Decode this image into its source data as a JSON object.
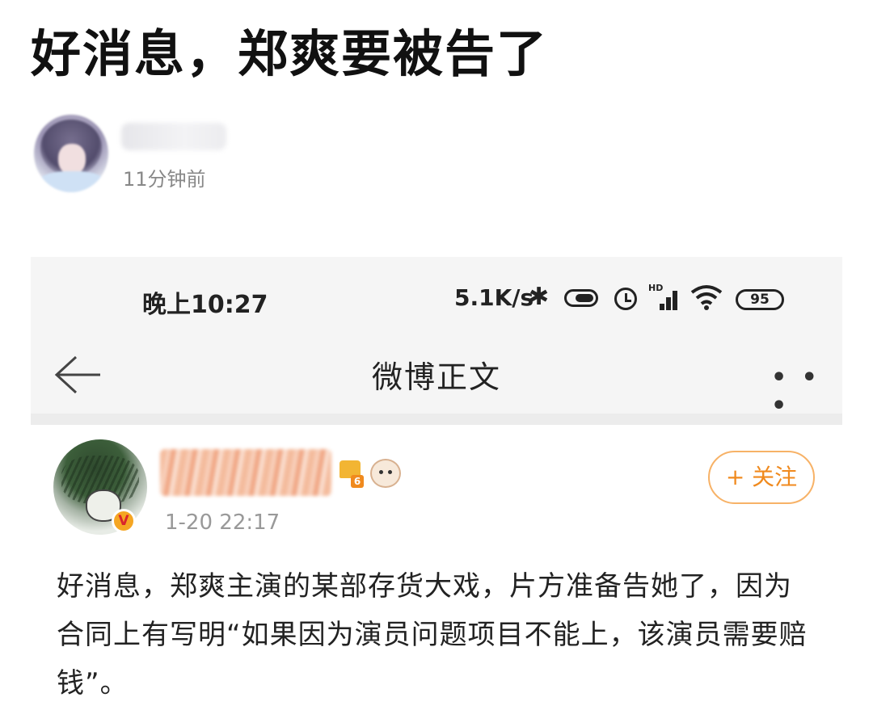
{
  "post": {
    "title": "好消息，郑爽要被告了",
    "time_ago": "11分钟前"
  },
  "screenshot": {
    "status_bar": {
      "time": "晚上10:27",
      "network_speed": "5.1K/s",
      "battery": "95",
      "icons": [
        "bluetooth-icon",
        "toggle-icon",
        "alarm-icon",
        "hd-signal-icon",
        "wifi-icon",
        "battery-icon"
      ]
    },
    "nav": {
      "title": "微博正文",
      "more": "• • •"
    },
    "weibo": {
      "time": "1-20 22:17",
      "verified": "V",
      "level": "6",
      "follow_label": "+ 关注",
      "text": "好消息，郑爽主演的某部存货大戏，片方准备告她了，因为合同上有写明“如果因为演员问题项目不能上，该演员需要赔钱”。"
    },
    "colors": {
      "follow_orange": "#f08a1e",
      "follow_border": "#f7b267",
      "muted_gray": "#999999"
    }
  }
}
